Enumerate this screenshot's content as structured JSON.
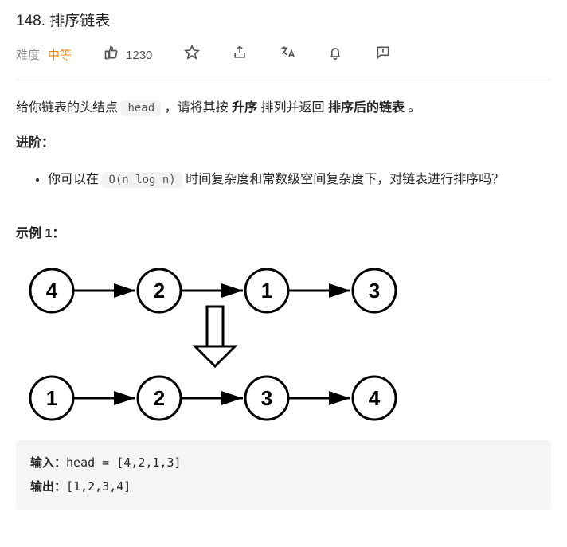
{
  "problem": {
    "number": "148",
    "title": "排序链表",
    "full_title": "148. 排序链表"
  },
  "meta": {
    "difficulty_label": "难度",
    "difficulty_value": "中等",
    "likes": "1230"
  },
  "description": {
    "p1_a": "给你链表的头结点 ",
    "code_head": "head",
    "p1_b": " ，请将其按 ",
    "bold_asc": "升序",
    "p1_c": " 排列并返回 ",
    "bold_sorted": "排序后的链表",
    "p1_d": " 。"
  },
  "advanced": {
    "heading": "进阶：",
    "li_a": "你可以在 ",
    "code_complexity": "O(n log n)",
    "li_b": " 时间复杂度和常数级空间复杂度下，对链表进行排序吗？"
  },
  "example1": {
    "heading": "示例 1：",
    "input_label": "输入：",
    "input_value": "head = [4,2,1,3]",
    "output_label": "输出：",
    "output_value": "[1,2,3,4]"
  },
  "chart_data": {
    "type": "diagram",
    "description": "linked list before and after sorting",
    "before": [
      4,
      2,
      1,
      3
    ],
    "after": [
      1,
      2,
      3,
      4
    ]
  }
}
